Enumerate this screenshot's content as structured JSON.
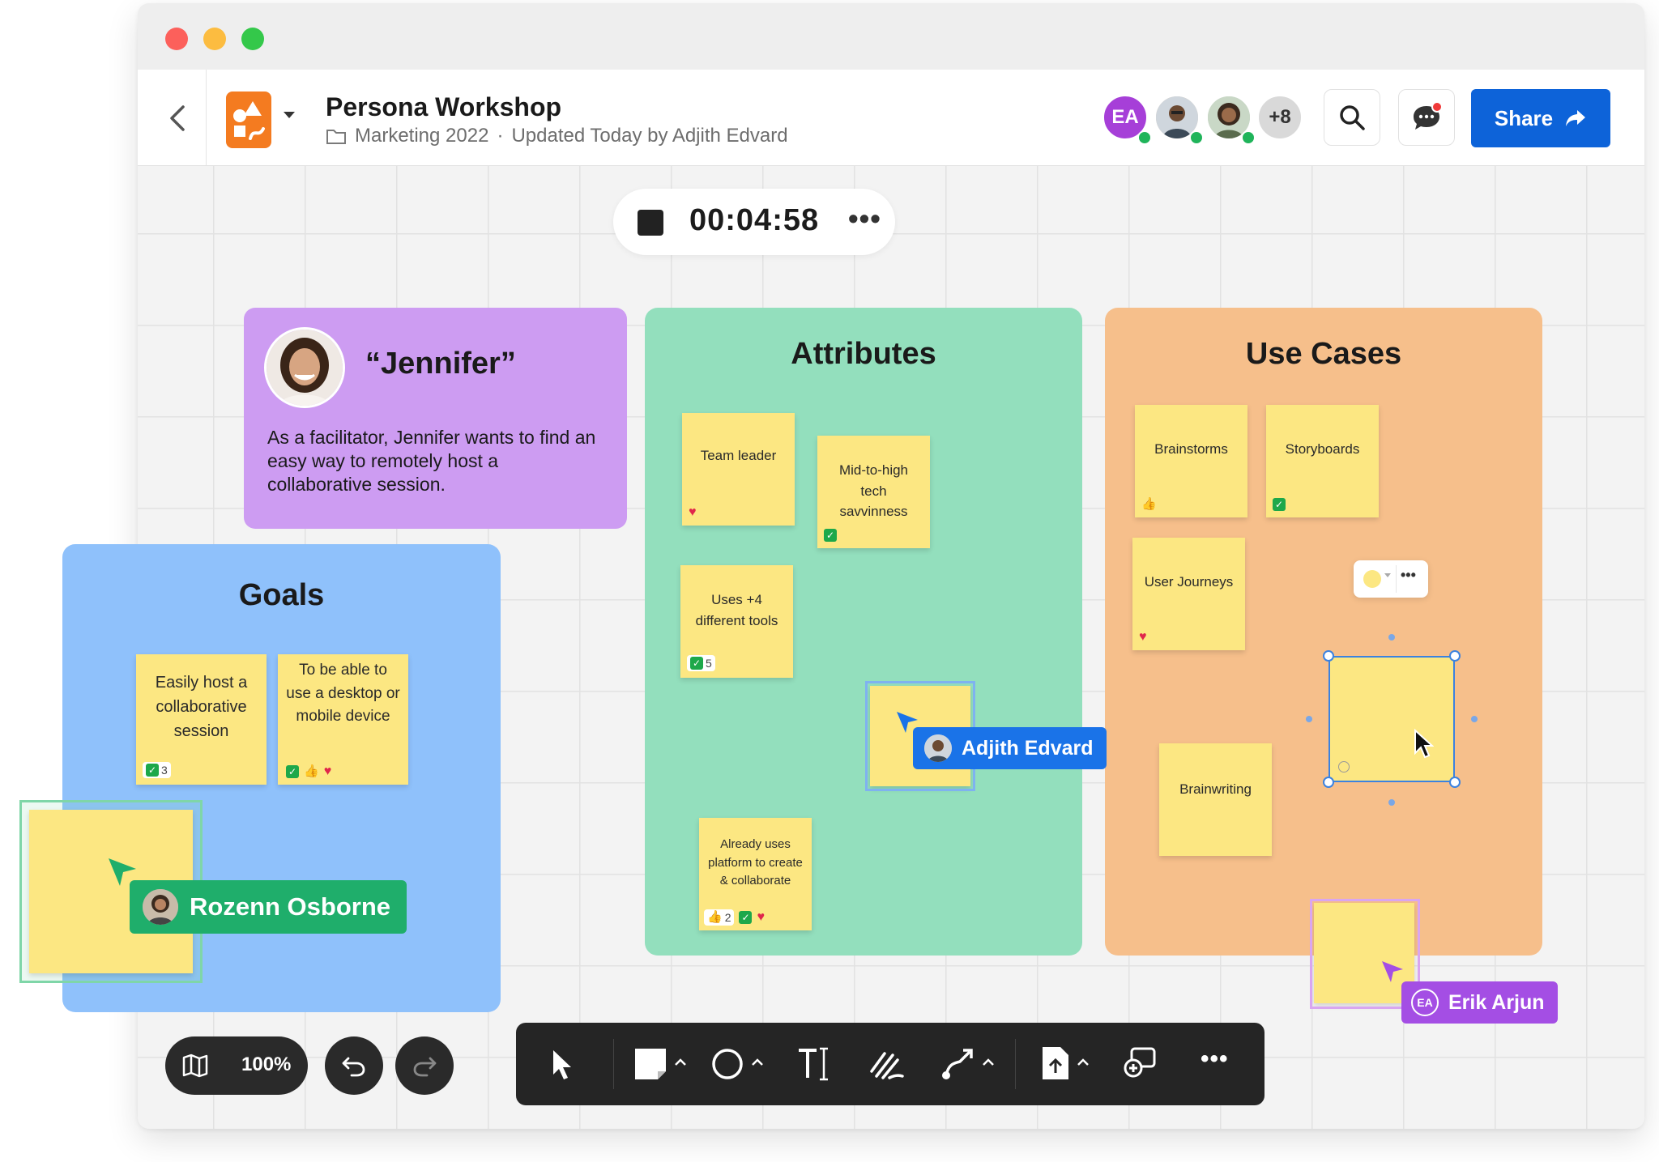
{
  "doc": {
    "title": "Persona Workshop",
    "folder": "Marketing 2022",
    "separator": "·",
    "updated": "Updated Today by Adjith Edvard"
  },
  "header": {
    "avatar_initials": "EA",
    "more_count": "+8",
    "share_label": "Share"
  },
  "timer": {
    "value": "00:04:58",
    "more": "•••"
  },
  "persona": {
    "name": "“Jennifer”",
    "description": "As a facilitator, Jennifer wants to find an easy way to remotely host a collaborative session."
  },
  "goals": {
    "title": "Goals",
    "notes": [
      {
        "text": "Easily host a collaborative session",
        "check_count": "3"
      },
      {
        "text": "To be able to use a desktop or mobile device"
      }
    ]
  },
  "attributes": {
    "title": "Attributes",
    "notes": [
      {
        "text": "Team leader"
      },
      {
        "text": "Mid-to-high tech savvinness"
      },
      {
        "text": "Uses +4 different tools",
        "check_count": "5"
      },
      {
        "text": "Already uses platform to create & collaborate",
        "thumb_count": "2"
      }
    ]
  },
  "use_cases": {
    "title": "Use Cases",
    "notes": [
      {
        "text": "Brainstorms"
      },
      {
        "text": "Storyboards"
      },
      {
        "text": "User Journeys"
      },
      {
        "text": "Brainwriting"
      }
    ],
    "note_menu_more": "•••"
  },
  "cursors": {
    "adjith": "Adjith Edvard",
    "rozenn": "Rozenn Osborne",
    "erik": "Erik Arjun",
    "erik_initials": "EA"
  },
  "bottom": {
    "zoom": "100%",
    "more": "•••"
  },
  "colors": {
    "accent": "#0d63d9",
    "persona": "#cd9cf2",
    "attributes": "#93dfbd",
    "use_cases": "#f6bf8b",
    "goals": "#8fc1fb",
    "sticky": "#fce782",
    "adjith_cursor": "#1a73e8",
    "rozenn_cursor": "#1fae6b",
    "erik_cursor": "#a44ee4"
  },
  "icons": [
    "back-chevron-icon",
    "document-icon",
    "folder-icon",
    "search-icon",
    "chat-icon",
    "share-arrow-icon",
    "map-icon",
    "undo-icon",
    "redo-icon",
    "select-arrow-icon",
    "sticky-note-icon",
    "shape-icon",
    "text-icon",
    "pen-icon",
    "connector-icon",
    "upload-icon",
    "comment-icon",
    "more-icon"
  ]
}
